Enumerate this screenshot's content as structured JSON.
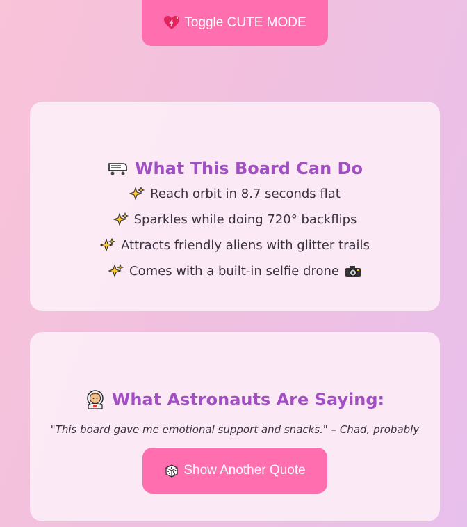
{
  "toggle": {
    "label": "Toggle CUTE MODE",
    "icon": "sparkling-heart-icon"
  },
  "features": {
    "title": "What This Board Can Do",
    "title_icon": "skateboard-icon",
    "items": [
      {
        "text": "Reach orbit in 8.7 seconds flat",
        "icon": "sparkles-icon"
      },
      {
        "text": "Sparkles while doing 720° backflips",
        "icon": "sparkles-icon"
      },
      {
        "text": "Attracts friendly aliens with glitter trails",
        "icon": "sparkles-icon"
      },
      {
        "text": "Comes with a built-in selfie drone",
        "icon": "sparkles-icon",
        "trailing_icon": "camera-icon"
      }
    ]
  },
  "testimonials": {
    "title": "What Astronauts Are Saying:",
    "title_icon": "astronaut-icon",
    "quote": "\"This board gave me emotional support and snacks.\" – Chad, probably",
    "button_label": "Show Another Quote",
    "button_icon": "dice-icon"
  },
  "colors": {
    "accent": "#ff6fb0",
    "heading": "#a24ec4",
    "card_bg": "#fceef6"
  }
}
